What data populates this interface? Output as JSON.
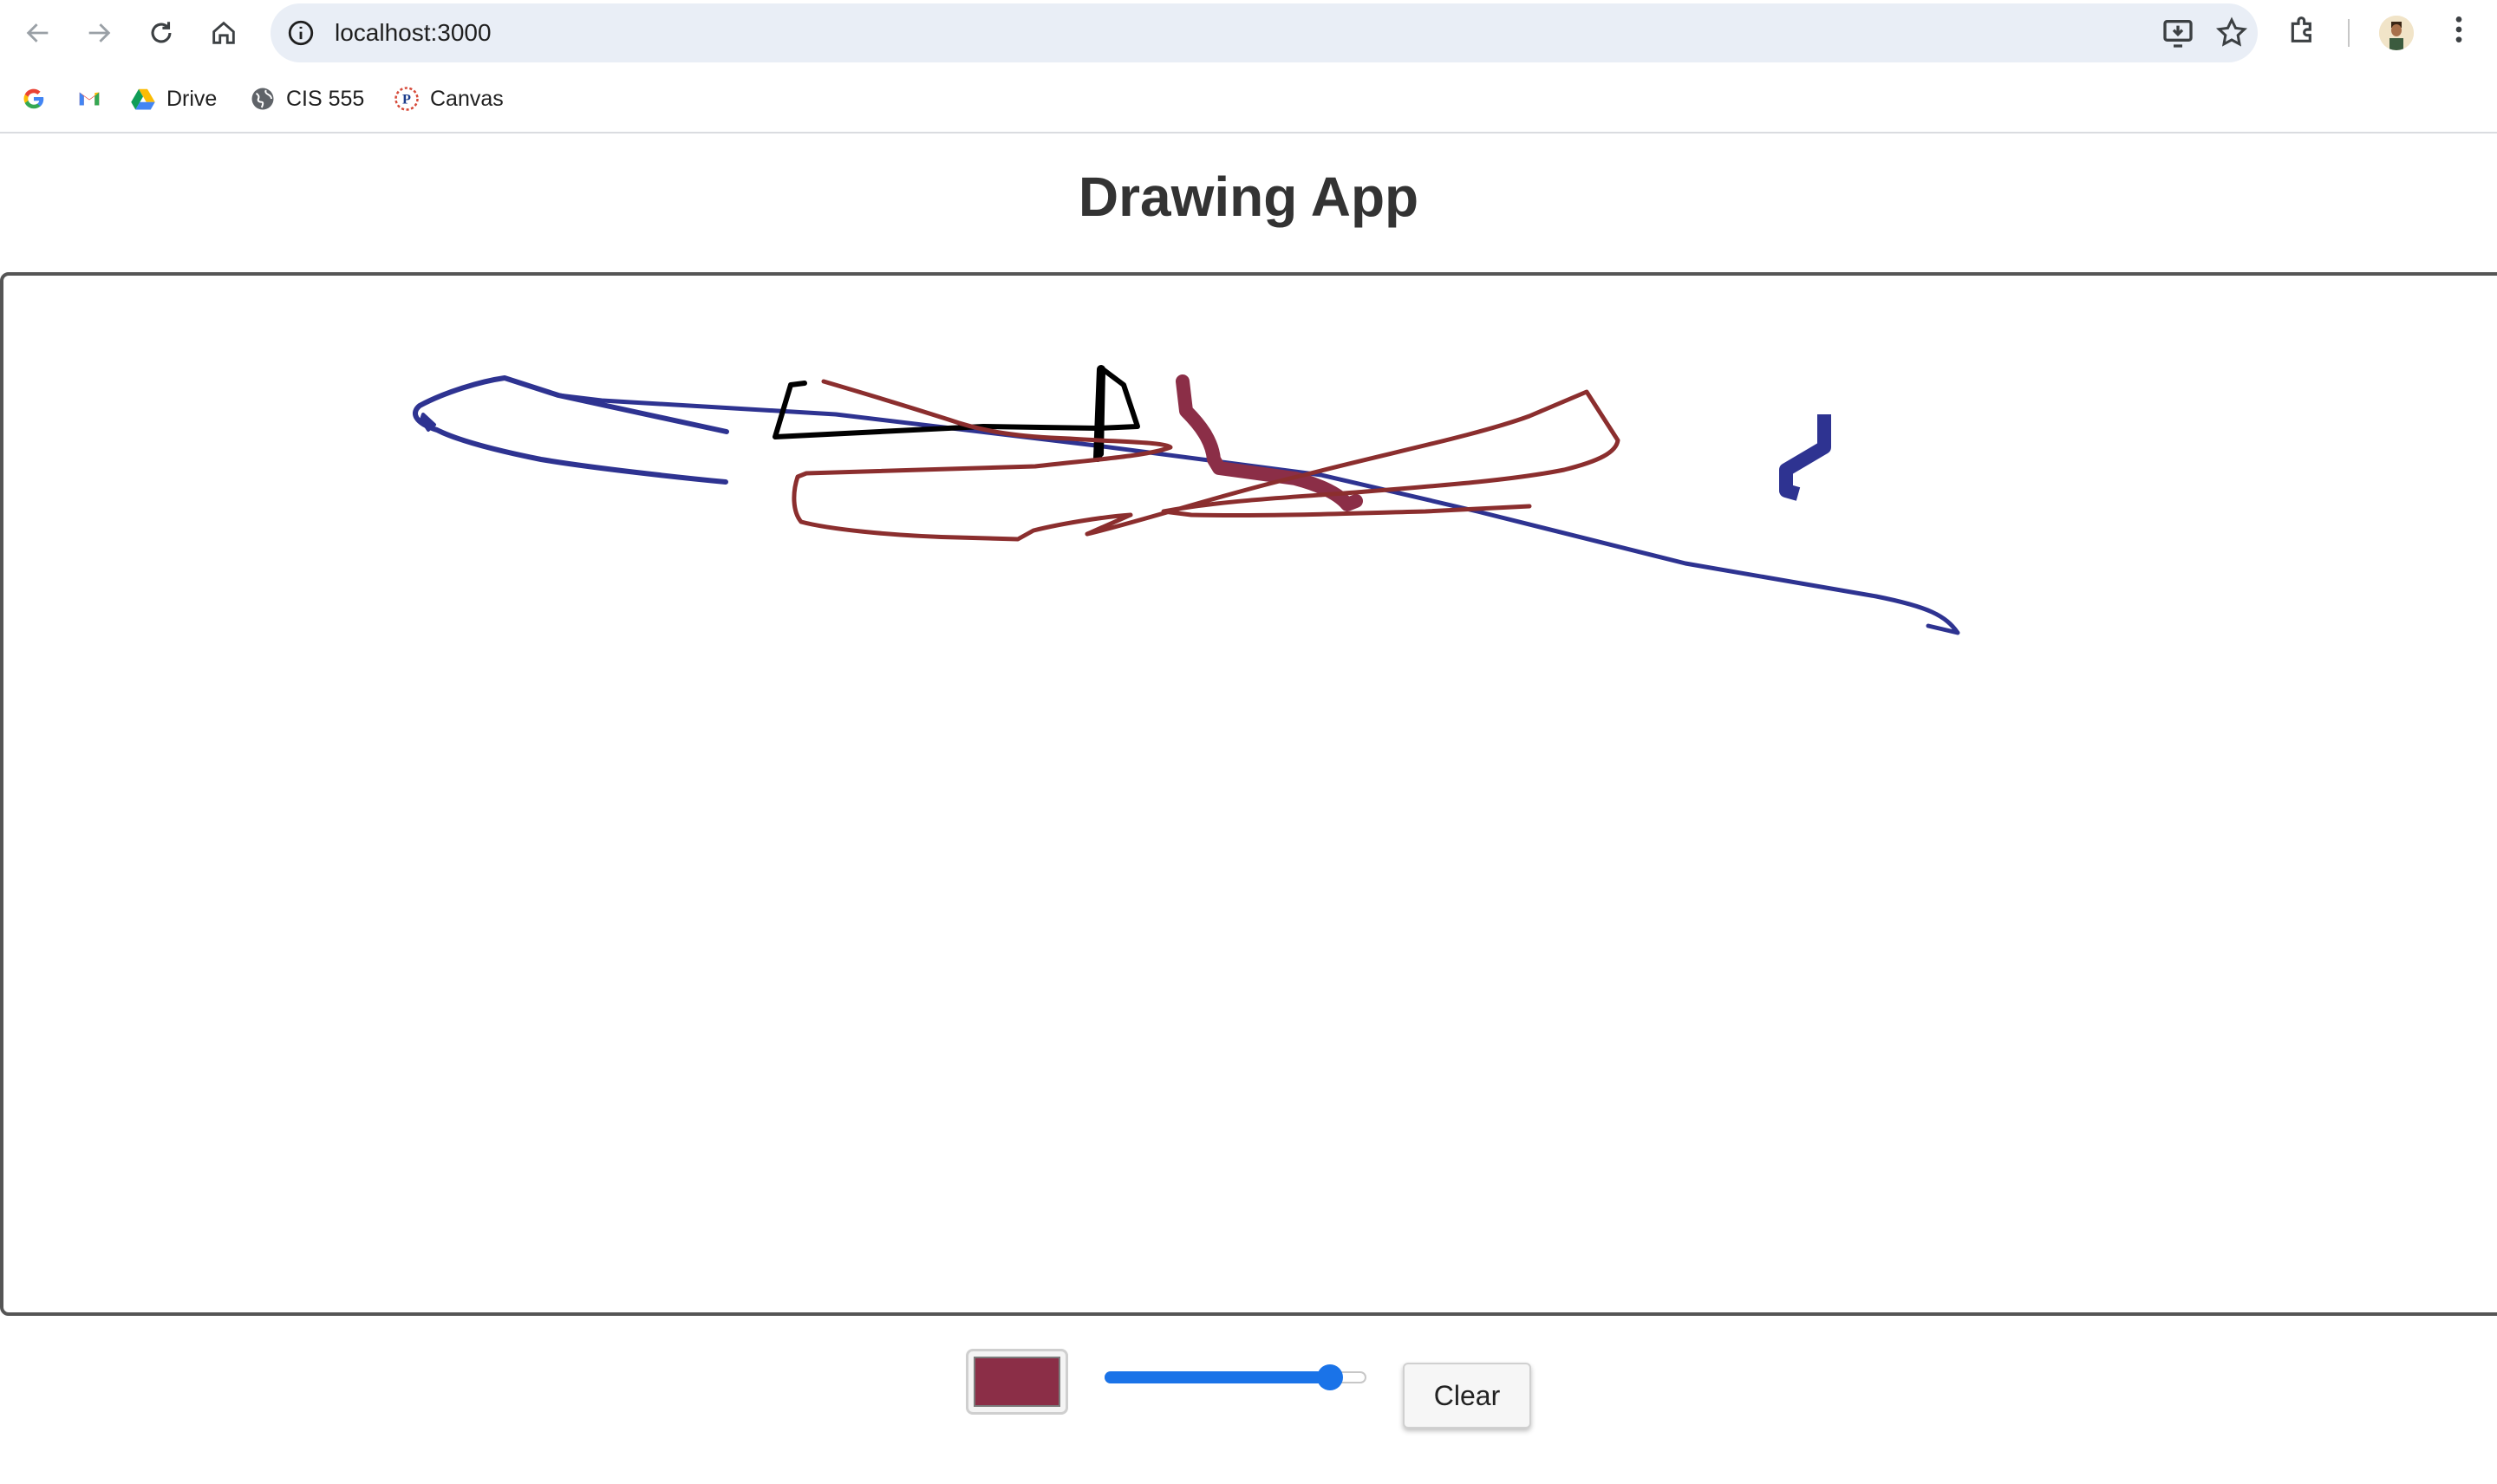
{
  "browser": {
    "url": "localhost:3000",
    "bookmarks": [
      {
        "label": "",
        "icon": "google-icon"
      },
      {
        "label": "",
        "icon": "gmail-icon"
      },
      {
        "label": "Drive",
        "icon": "drive-icon"
      },
      {
        "label": "CIS 555",
        "icon": "globe-icon"
      },
      {
        "label": "Canvas",
        "icon": "canvas-icon"
      }
    ]
  },
  "app": {
    "title": "Drawing App",
    "selected_color": "#8b2e47",
    "brush_size_fraction": 0.9,
    "clear_label": "Clear"
  },
  "colors": {
    "navy_stroke": "#2e3391",
    "maroon_stroke": "#8b2e2e",
    "black_stroke": "#000000",
    "accent": "#1a73e8"
  }
}
